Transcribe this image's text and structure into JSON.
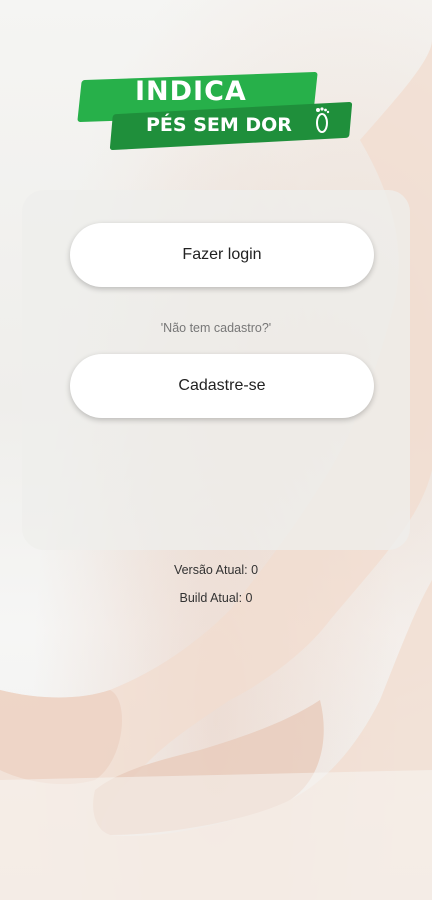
{
  "brand": {
    "line1": "INDICA",
    "line2": "PÉS SEM DOR",
    "icon": "foot-icon",
    "colors": {
      "primary": "#27b04a",
      "secondary": "#1f8f3b"
    }
  },
  "auth": {
    "login_label": "Fazer login",
    "signup_prompt": "'Não tem cadastro?'",
    "signup_label": "Cadastre-se"
  },
  "app_info": {
    "version": "Versão Atual: 0",
    "build": "Build Atual: 0"
  }
}
